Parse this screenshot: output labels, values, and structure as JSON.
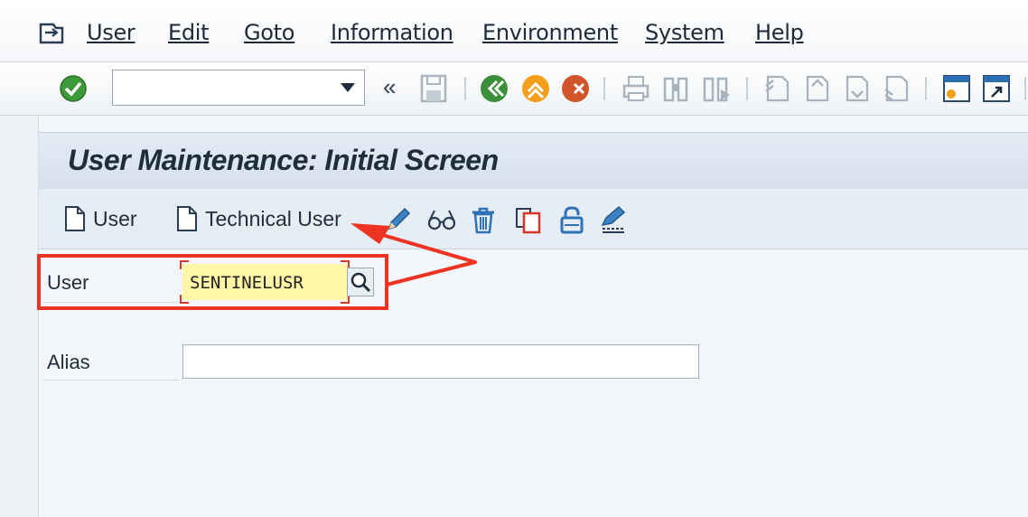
{
  "menubar": {
    "items": [
      {
        "label": "User",
        "accel": "U"
      },
      {
        "label": "Edit",
        "accel": "E"
      },
      {
        "label": "Goto",
        "accel": "G"
      },
      {
        "label": "Information",
        "accel": "I"
      },
      {
        "label": "Environment",
        "accel": "v"
      },
      {
        "label": "System",
        "accel": "y"
      },
      {
        "label": "Help",
        "accel": "H"
      }
    ]
  },
  "toolbar": {
    "command_field_value": "",
    "back_chevron": "«",
    "icons": [
      "enter-icon",
      "save-icon",
      "back-icon",
      "exit-icon",
      "cancel-icon",
      "print-icon",
      "find-icon",
      "find-next-icon",
      "first-page-icon",
      "previous-page-icon",
      "next-page-icon",
      "last-page-icon",
      "new-session-icon",
      "create-shortcut-icon"
    ]
  },
  "screen": {
    "title": "User Maintenance: Initial Screen"
  },
  "app_toolbar": {
    "create_user_label": "User",
    "technical_user_label": "Technical User",
    "icons": [
      "change-pencil-icon",
      "display-glasses-icon",
      "delete-trash-icon",
      "copy-icon",
      "lock-unlock-icon",
      "change-password-icon"
    ]
  },
  "form": {
    "user_label": "User",
    "user_value": "SENTINELUSR",
    "alias_label": "Alias",
    "alias_value": ""
  },
  "colors": {
    "annotation_red": "#ee3322",
    "highlight_field": "#fff6a8",
    "title_bar": "#d5e0ec"
  }
}
